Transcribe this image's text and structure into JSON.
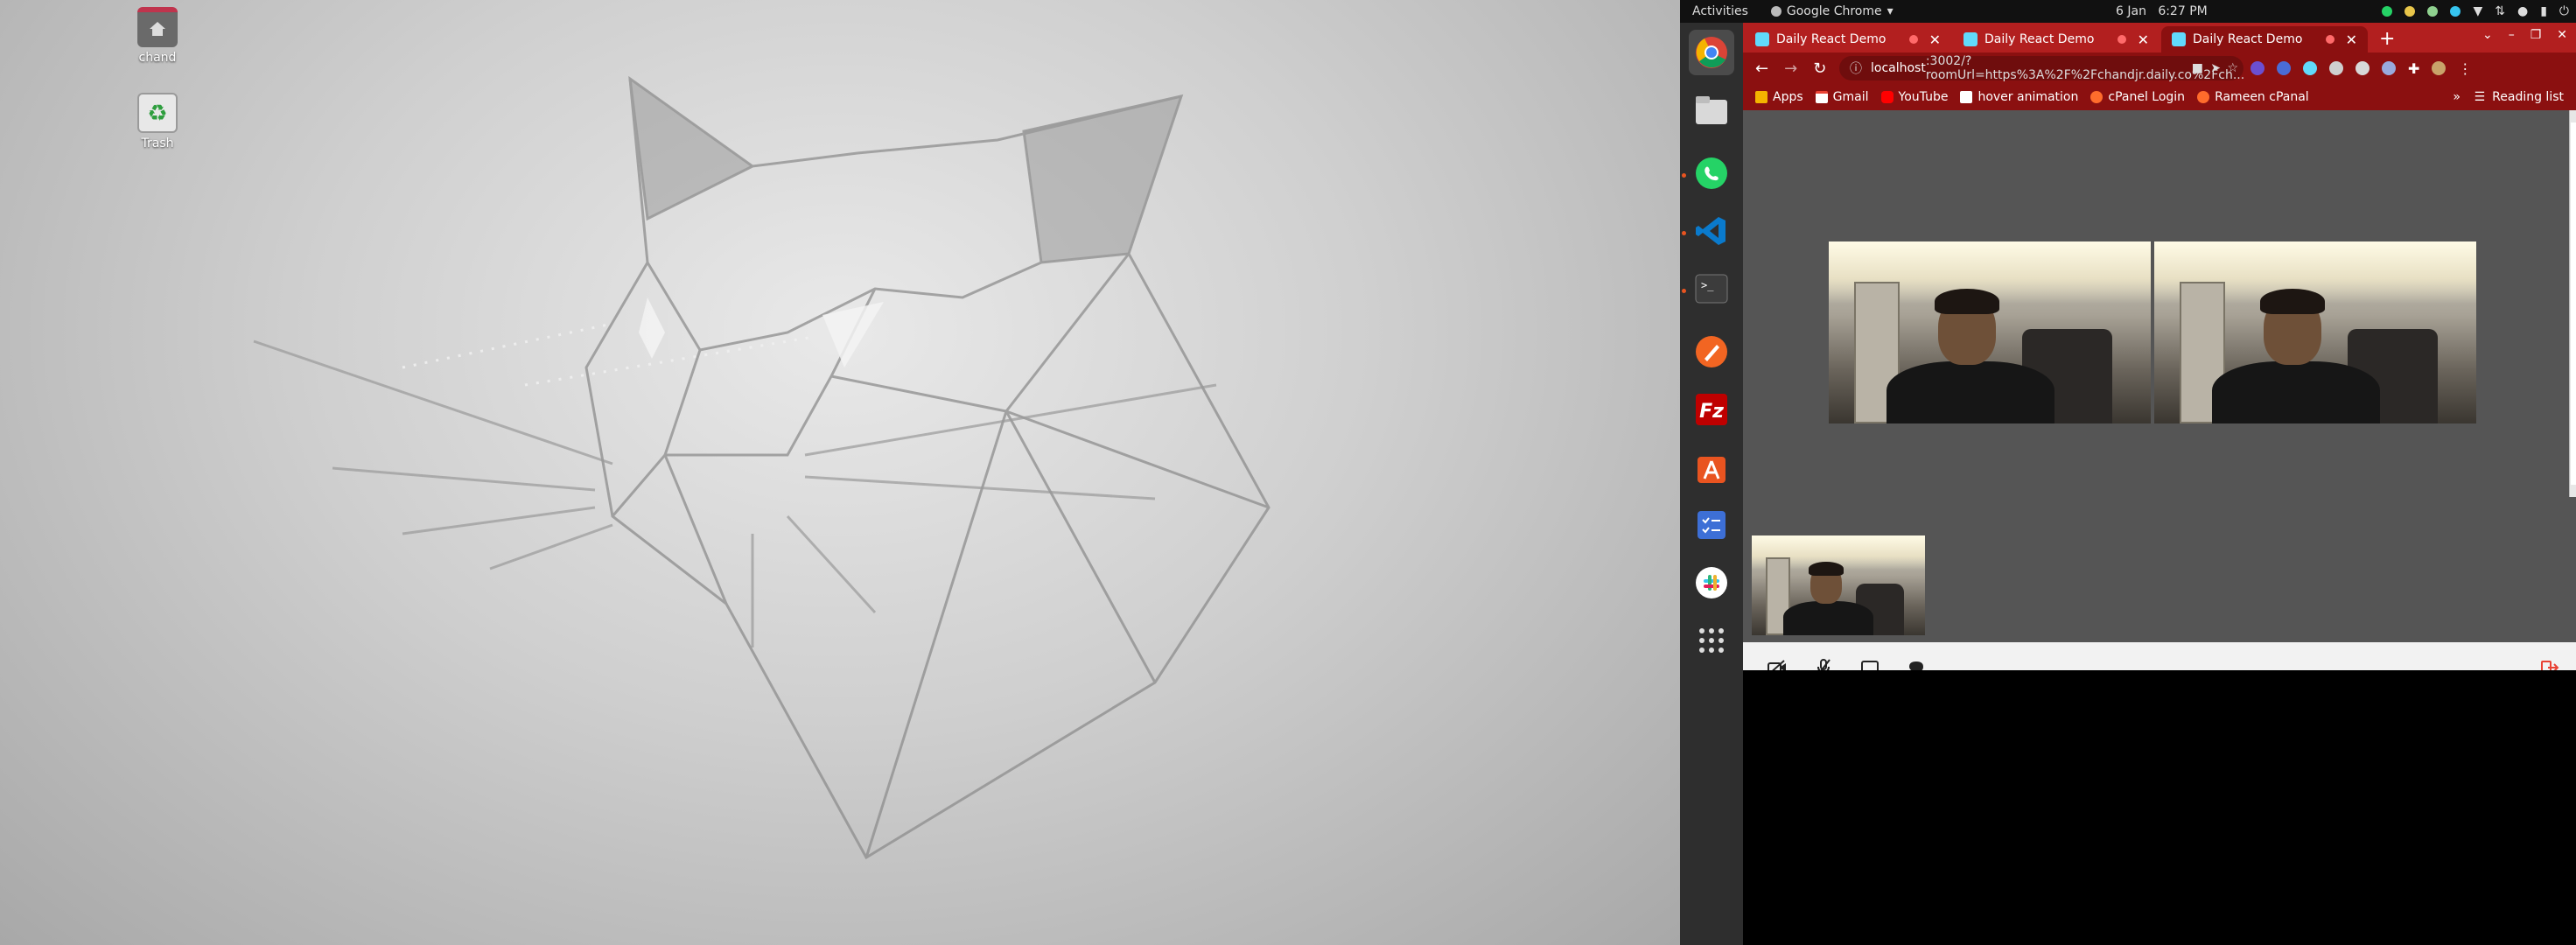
{
  "desktop": {
    "icons": [
      {
        "name": "chand",
        "icon": "home-folder-icon"
      },
      {
        "name": "Trash",
        "icon": "trash-icon"
      }
    ]
  },
  "topbar": {
    "activities": "Activities",
    "app_menu": "Google Chrome",
    "date": "6 Jan",
    "time": "6:27 PM"
  },
  "dock": {
    "items": [
      {
        "name": "chrome-icon"
      },
      {
        "name": "files-icon"
      },
      {
        "name": "whatsapp-icon"
      },
      {
        "name": "vscode-icon"
      },
      {
        "name": "terminal-icon"
      },
      {
        "name": "inkscape-icon"
      },
      {
        "name": "filezilla-icon"
      },
      {
        "name": "software-center-icon"
      },
      {
        "name": "todo-icon"
      },
      {
        "name": "slack-icon"
      },
      {
        "name": "show-apps-icon"
      }
    ]
  },
  "browser": {
    "tabs": [
      {
        "title": "Daily React Demo"
      },
      {
        "title": "Daily React Demo"
      },
      {
        "title": "Daily React Demo"
      }
    ],
    "new_tab": "+",
    "url_host": "localhost",
    "url_rest": ":3002/?roomUrl=https%3A%2F%2Fchandjr.daily.co%2Fch...",
    "bookmarks": [
      {
        "label": "Apps",
        "color": "#f4b400"
      },
      {
        "label": "Gmail",
        "color": "#ea4335"
      },
      {
        "label": "YouTube",
        "color": "#ff0000"
      },
      {
        "label": "hover animation",
        "color": "#ffffff"
      },
      {
        "label": "cPanel Login",
        "color": "#ff6c2c"
      },
      {
        "label": "Rameen cPanal",
        "color": "#ff6c2c"
      }
    ],
    "overflow": "»",
    "reading_list": "Reading list"
  },
  "call": {
    "controls": [
      {
        "name": "camera-off-icon"
      },
      {
        "name": "mic-off-icon"
      },
      {
        "name": "screen-share-icon"
      },
      {
        "name": "chat-icon"
      }
    ],
    "leave": "leave-call-icon"
  },
  "colors": {
    "tab_strip": "#b21f1f",
    "toolbar": "#8b1010",
    "dock": "#2e2e2e",
    "accent": "#e95420"
  }
}
